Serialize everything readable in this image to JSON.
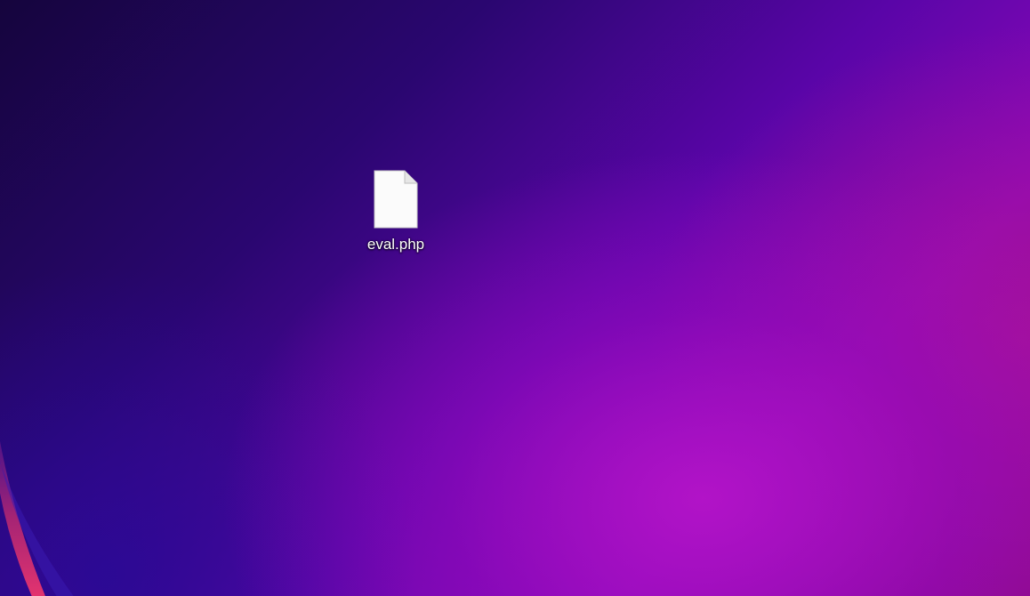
{
  "desktop": {
    "icons": [
      {
        "label": "eval.php",
        "icon": "document-file-icon"
      }
    ]
  }
}
